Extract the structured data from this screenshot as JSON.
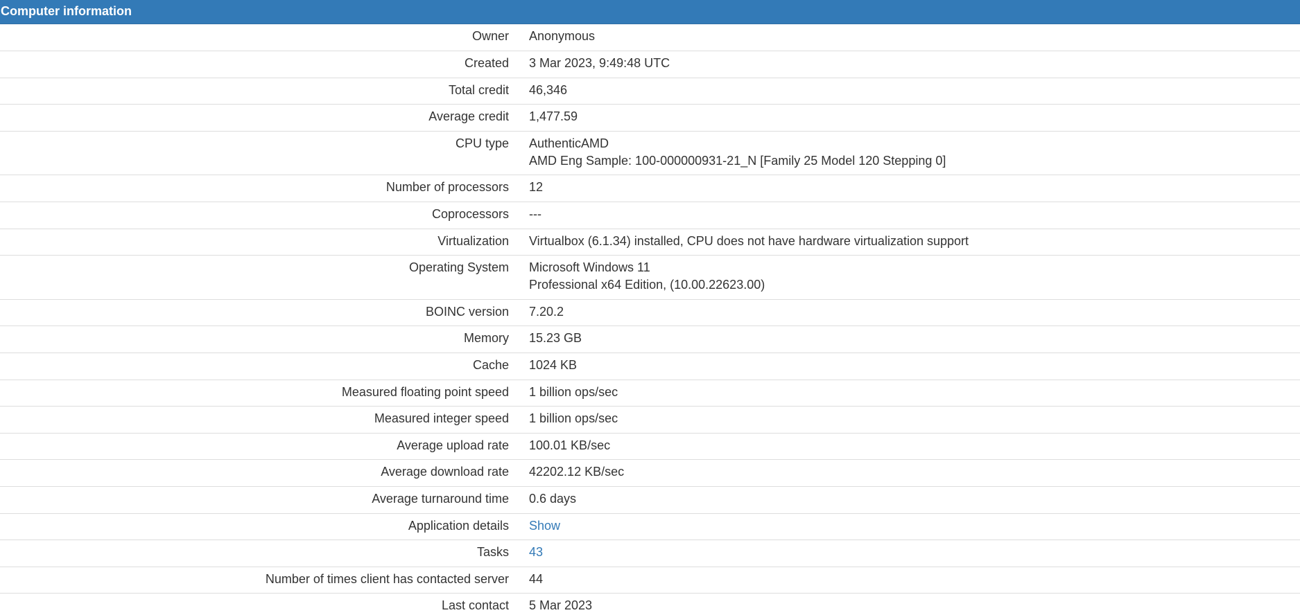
{
  "panel": {
    "title": "Computer information"
  },
  "rows": [
    {
      "label": "Owner",
      "value": "Anonymous"
    },
    {
      "label": "Created",
      "value": "3 Mar 2023, 9:49:48 UTC"
    },
    {
      "label": "Total credit",
      "value": "46,346"
    },
    {
      "label": "Average credit",
      "value": "1,477.59"
    },
    {
      "label": "CPU type",
      "value_line1": "AuthenticAMD",
      "value_line2": "AMD Eng Sample: 100-000000931-21_N [Family 25 Model 120 Stepping 0]"
    },
    {
      "label": "Number of processors",
      "value": "12"
    },
    {
      "label": "Coprocessors",
      "value": "---"
    },
    {
      "label": "Virtualization",
      "value": "Virtualbox (6.1.34) installed, CPU does not have hardware virtualization support"
    },
    {
      "label": "Operating System",
      "value_line1": "Microsoft Windows 11",
      "value_line2": "Professional x64 Edition, (10.00.22623.00)"
    },
    {
      "label": "BOINC version",
      "value": "7.20.2"
    },
    {
      "label": "Memory",
      "value": "15.23 GB"
    },
    {
      "label": "Cache",
      "value": "1024 KB"
    },
    {
      "label": "Measured floating point speed",
      "value": "1 billion ops/sec"
    },
    {
      "label": "Measured integer speed",
      "value": "1 billion ops/sec"
    },
    {
      "label": "Average upload rate",
      "value": "100.01 KB/sec"
    },
    {
      "label": "Average download rate",
      "value": "42202.12 KB/sec"
    },
    {
      "label": "Average turnaround time",
      "value": "0.6 days"
    },
    {
      "label": "Application details",
      "value": "Show"
    },
    {
      "label": "Tasks",
      "value": "43"
    },
    {
      "label": "Number of times client has contacted server",
      "value": "44"
    },
    {
      "label": "Last contact",
      "value": "5 Mar 2023"
    }
  ],
  "colors": {
    "header_bg": "#337ab7",
    "link": "#337ab7",
    "text": "#333333",
    "row_border": "#dddddd"
  }
}
